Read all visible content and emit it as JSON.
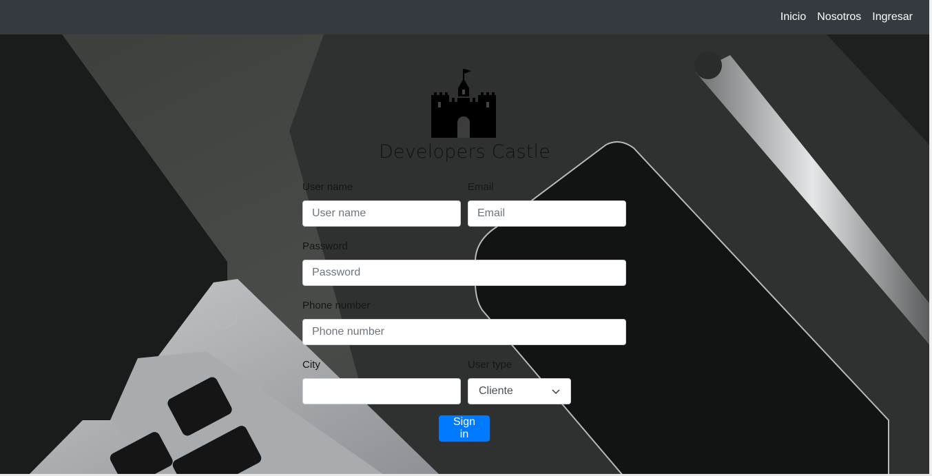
{
  "nav": {
    "links": [
      "Inicio",
      "Nosotros",
      "Ingresar"
    ]
  },
  "brand": {
    "title": "Developers Castle",
    "logo_icon": "castle-icon"
  },
  "form": {
    "username": {
      "label": "User name",
      "placeholder": "User name",
      "value": ""
    },
    "email": {
      "label": "Email",
      "placeholder": "Email",
      "value": ""
    },
    "password": {
      "label": "Password",
      "placeholder": "Password",
      "value": ""
    },
    "phone": {
      "label": "Phone number",
      "placeholder": "Phone number",
      "value": ""
    },
    "city": {
      "label": "City",
      "placeholder": "",
      "value": ""
    },
    "user_type": {
      "label": "User type",
      "selected": "Cliente"
    },
    "submit_label": "Sign in"
  },
  "colors": {
    "navbar": "#343a40",
    "primary_button": "#007bff"
  }
}
